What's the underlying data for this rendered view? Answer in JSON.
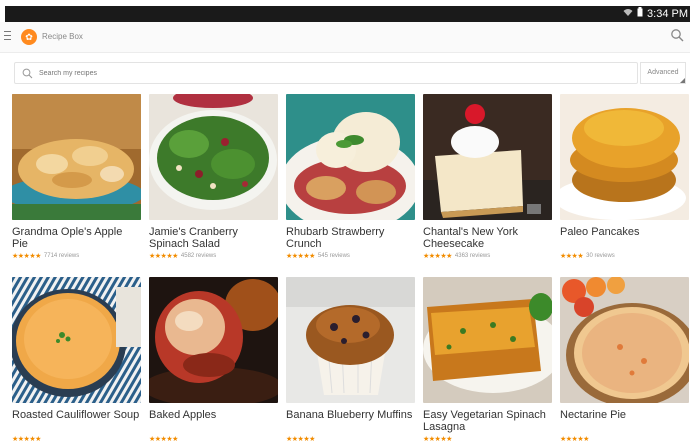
{
  "status": {
    "time": "3:34 PM"
  },
  "app": {
    "title": "Recipe Box"
  },
  "search": {
    "placeholder": "Search my recipes",
    "advanced_label": "Advanced"
  },
  "recipes": [
    {
      "title": "Grandma Ople's Apple Pie",
      "stars": "★★★★★",
      "reviews": "7714 reviews"
    },
    {
      "title": "Jamie's Cranberry Spinach Salad",
      "stars": "★★★★★",
      "reviews": "4582 reviews"
    },
    {
      "title": "Rhubarb Strawberry Crunch",
      "stars": "★★★★★",
      "reviews": "545 reviews"
    },
    {
      "title": "Chantal's New York Cheesecake",
      "stars": "★★★★★",
      "reviews": "4363 reviews"
    },
    {
      "title": "Paleo Pancakes",
      "stars": "★★★★",
      "reviews": "30 reviews"
    },
    {
      "title": "Roasted Cauliflower Soup",
      "stars": "★★★★★",
      "reviews": ""
    },
    {
      "title": "Baked Apples",
      "stars": "★★★★★",
      "reviews": ""
    },
    {
      "title": "Banana Blueberry Muffins",
      "stars": "★★★★★",
      "reviews": ""
    },
    {
      "title": "Easy Vegetarian Spinach Lasagna",
      "stars": "★★★★★",
      "reviews": ""
    },
    {
      "title": "Nectarine Pie",
      "stars": "★★★★★",
      "reviews": ""
    }
  ],
  "colors": {
    "accent": "#ff8a1f",
    "star": "#f28c00"
  }
}
